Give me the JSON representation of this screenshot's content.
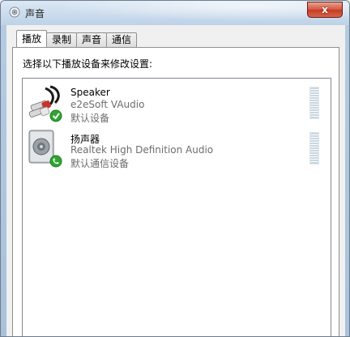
{
  "window": {
    "title": "声音",
    "close_label": "x"
  },
  "tabs": [
    {
      "label": "播放",
      "active": true
    },
    {
      "label": "录制",
      "active": false
    },
    {
      "label": "声音",
      "active": false
    },
    {
      "label": "通信",
      "active": false
    }
  ],
  "panel": {
    "instruction": "选择以下播放设备来修改设置:"
  },
  "devices": [
    {
      "name": "Speaker",
      "description": "e2eSoft VAudio",
      "status": "默认设备",
      "icon": "rca-cable-icon",
      "badge": "green-check-icon"
    },
    {
      "name": "扬声器",
      "description": "Realtek High Definition Audio",
      "status": "默认通信设备",
      "icon": "speaker-icon",
      "badge": "green-phone-icon"
    }
  ],
  "colors": {
    "title_bar": "#c6d8ea",
    "close_button": "#c43b24",
    "secondary_text": "#6d6d6d",
    "meter": "#c9d6df",
    "badge_green": "#2fa532"
  }
}
